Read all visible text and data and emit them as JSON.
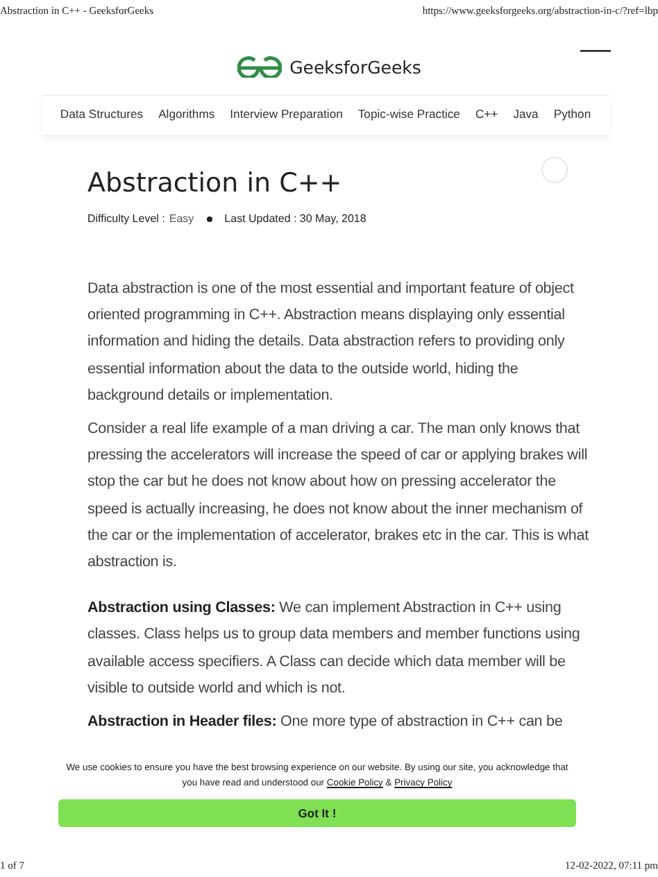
{
  "print_header": {
    "title": "Abstraction in C++ - GeeksforGeeks",
    "url": "https://www.geeksforgeeks.org/abstraction-in-c/?ref=lbp"
  },
  "site": {
    "name": "GeeksforGeeks"
  },
  "nav": [
    {
      "label": "Data Structures"
    },
    {
      "label": "Algorithms"
    },
    {
      "label": "Interview Preparation"
    },
    {
      "label": "Topic-wise Practice"
    },
    {
      "label": "C++"
    },
    {
      "label": "Java"
    },
    {
      "label": "Python"
    }
  ],
  "article": {
    "title": "Abstraction in C++",
    "difficulty_label": "Difficulty Level :",
    "difficulty": "Easy",
    "last_updated": "Last Updated : 30 May, 2018",
    "paragraphs": [
      "Data abstraction is one of the most essential and important feature of object oriented programming in C++. Abstraction means displaying only essential information and hiding the details. Data abstraction refers to providing only essential information about the data to the outside world, hiding the background details or implementation.",
      "Consider a real life example of a man driving a car. The man only knows that pressing the accelerators will increase the speed of car or applying brakes will stop the car but he does not know about how on pressing accelerator the speed is actually increasing, he does not know about the inner mechanism of the car or the implementation of accelerator, brakes etc in the car. This is what abstraction is.",
      "**Abstraction using Classes:** We can implement Abstraction in C++ using classes. Class helps us to group data members and member functions using available access specifiers. A Class can decide which data member will be visible to outside world and which is not.",
      "**Abstraction in Header files:** One more type of abstraction in C++ can be"
    ]
  },
  "cookie_banner": {
    "text": "We use cookies to ensure you have the best browsing experience on our website. By using our site, you acknowledge that you have read and understood our",
    "links": [
      "Cookie Policy",
      "Privacy Policy"
    ],
    "joiner": "&",
    "button": "Got It !"
  },
  "print_footer": {
    "page": "1 of 7",
    "datetime": "12-02-2022, 07:11 pm"
  }
}
